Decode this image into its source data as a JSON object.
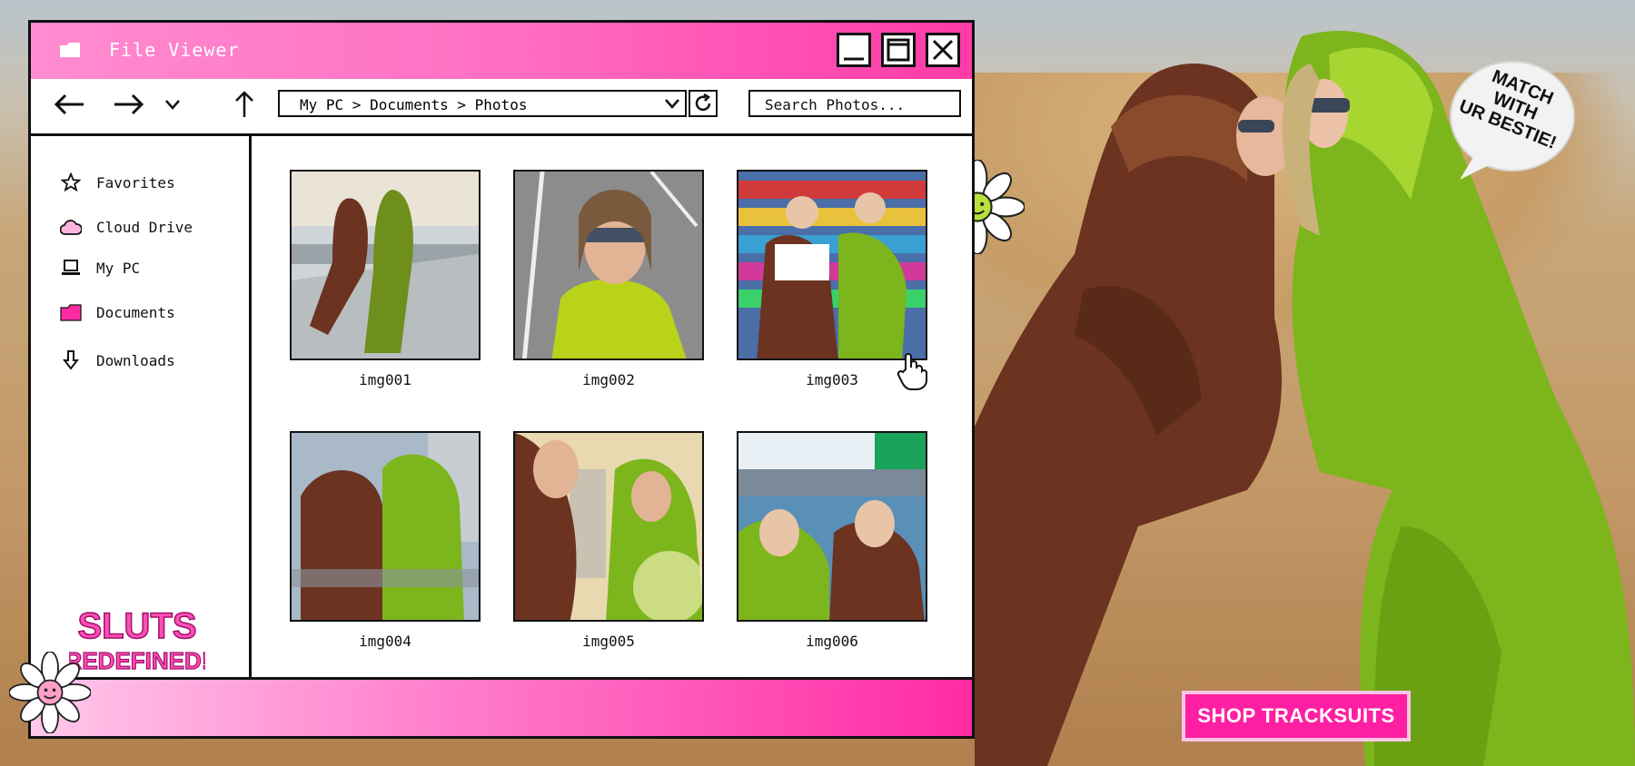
{
  "window": {
    "title": "File Viewer",
    "controls": [
      "minimize",
      "maximize",
      "close"
    ]
  },
  "toolbar": {
    "address_path": "My PC > Documents > Photos",
    "search_placeholder": "Search Photos..."
  },
  "sidebar": {
    "items": [
      {
        "label": "Favorites",
        "icon": "star-icon"
      },
      {
        "label": "Cloud Drive",
        "icon": "cloud-icon"
      },
      {
        "label": "My PC",
        "icon": "laptop-icon"
      },
      {
        "label": "Documents",
        "icon": "folder-icon"
      },
      {
        "label": "Downloads",
        "icon": "download-arrow-icon"
      }
    ],
    "brand": {
      "line1": "SLUTS",
      "line2": "REDEFINED!"
    }
  },
  "files": [
    {
      "name": "img001"
    },
    {
      "name": "img002"
    },
    {
      "name": "img003"
    },
    {
      "name": "img004"
    },
    {
      "name": "img005"
    },
    {
      "name": "img006"
    }
  ],
  "promo": {
    "button_label": "SHOP TRACKSUITS",
    "bubble_line1": "MATCH WITH",
    "bubble_line2": "UR BESTIE!"
  },
  "colors": {
    "accent_pink": "#ff3aa9",
    "brand_pink": "#ff1fa2",
    "velour_green": "#7db51c",
    "velour_brown": "#6b3320"
  }
}
